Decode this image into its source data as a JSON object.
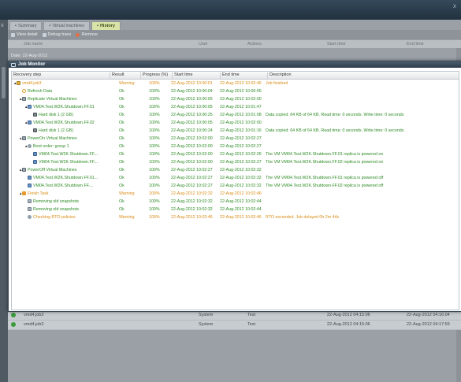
{
  "window": {
    "close_glyph": "x"
  },
  "tabs": [
    {
      "label": "Summary",
      "active": false
    },
    {
      "label": "Virtual machines",
      "active": false
    },
    {
      "label": "History",
      "active": true
    }
  ],
  "toolbar": {
    "view_detail": "View detail",
    "debug_trace": "Debug trace",
    "remove": "Remove"
  },
  "background_table": {
    "headers": {
      "job_name": "Job name",
      "user": "User",
      "actions": "Actions",
      "start": "Start time",
      "end": "End time"
    },
    "group_label": "Date: 22-Aug-2012",
    "rows": [
      {
        "name": "vmd4.job3",
        "user": "System",
        "action": "Test",
        "start": "22-Aug-2012 04:15:06",
        "end": "22-Aug-2012 04:16:04"
      },
      {
        "name": "vmd4.job3",
        "user": "System",
        "action": "Test",
        "start": "22-Aug-2012 04:15:06",
        "end": "22-Aug-2012 04:17:59"
      }
    ]
  },
  "dialog": {
    "title": "Job Monitor",
    "columns": {
      "step": "Recovery step",
      "result": "Result",
      "progress": "Progress (%)",
      "start": "Start time",
      "end": "End time",
      "description": "Description"
    },
    "rows": [
      {
        "indent": 0,
        "expander": "▲",
        "icon": "job",
        "step": "vmd4.job3",
        "result": "Warning",
        "progress": "100%",
        "start": "22-Aug-2012 10:00:01",
        "end": "22-Aug-2012 10:02:46",
        "description": "Job finished",
        "status": "warn"
      },
      {
        "indent": 1,
        "expander": "",
        "icon": "refresh",
        "step": "Refresh Data",
        "result": "Ok",
        "progress": "100%",
        "start": "22-Aug-2012 10:00:04",
        "end": "22-Aug-2012 10:00:05",
        "description": "",
        "status": "ok"
      },
      {
        "indent": 1,
        "expander": "▲",
        "icon": "repl",
        "step": "Replicate Virtual Machines",
        "result": "Ok",
        "progress": "100%",
        "start": "22-Aug-2012 10:00:05",
        "end": "22-Aug-2012 10:02:00",
        "description": "",
        "status": "ok"
      },
      {
        "indent": 2,
        "expander": "▲",
        "icon": "vm",
        "step": "VM04.Test.W2K.Shutdown.FF.01",
        "result": "Ok",
        "progress": "100%",
        "start": "22-Aug-2012 10:00:05",
        "end": "22-Aug-2012 10:01:47",
        "description": "",
        "status": "ok"
      },
      {
        "indent": 3,
        "expander": "",
        "icon": "disk",
        "step": "Hard disk 1 (2 GB)",
        "result": "Ok",
        "progress": "100%",
        "start": "22-Aug-2012 10:00:25",
        "end": "22-Aug-2012 10:01:08",
        "description": "Data copied: 64 KB of 64 KB. Read time: 0 seconds. Write time: 0 seconds",
        "status": "ok"
      },
      {
        "indent": 2,
        "expander": "▲",
        "icon": "vm",
        "step": "VM04.Test.W2K.Shutdown.FF.02",
        "result": "Ok",
        "progress": "100%",
        "start": "22-Aug-2012 10:00:05",
        "end": "22-Aug-2012 10:02:00",
        "description": "",
        "status": "ok"
      },
      {
        "indent": 3,
        "expander": "",
        "icon": "disk",
        "step": "Hard disk 1 (2 GB)",
        "result": "Ok",
        "progress": "100%",
        "start": "22-Aug-2012 10:00:24",
        "end": "22-Aug-2012 10:01:16",
        "description": "Data copied: 64 KB of 64 KB. Read time: 0 seconds. Write time: 0 seconds",
        "status": "ok"
      },
      {
        "indent": 1,
        "expander": "▲",
        "icon": "repl",
        "step": "PowerOn Virtual Machines",
        "result": "Ok",
        "progress": "100%",
        "start": "22-Aug-2012 10:02:00",
        "end": "22-Aug-2012 10:02:27",
        "description": "",
        "status": "ok"
      },
      {
        "indent": 2,
        "expander": "▲",
        "icon": "gear",
        "step": "Boot order: group 1",
        "result": "Ok",
        "progress": "100%",
        "start": "22-Aug-2012 10:02:00",
        "end": "22-Aug-2012 10:02:27",
        "description": "",
        "status": "ok"
      },
      {
        "indent": 3,
        "expander": "",
        "icon": "vm",
        "step": "VM04.Test.W2K.Shutdown.FF....",
        "result": "Ok",
        "progress": "100%",
        "start": "22-Aug-2012 10:02:00",
        "end": "22-Aug-2012 10:02:26",
        "description": "The VM VM04.Test.W2K.Shutdown.FF.01 replica is powered on",
        "status": "ok"
      },
      {
        "indent": 3,
        "expander": "",
        "icon": "vm",
        "step": "VM04.Test.W2K.Shutdown.FF....",
        "result": "Ok",
        "progress": "100%",
        "start": "22-Aug-2012 10:02:00",
        "end": "22-Aug-2012 10:02:27",
        "description": "The VM VM04.Test.W2K.Shutdown.FF.02 replica is powered on",
        "status": "ok"
      },
      {
        "indent": 1,
        "expander": "▲",
        "icon": "repl",
        "step": "PowerOff Virtual Machines",
        "result": "Ok",
        "progress": "100%",
        "start": "22-Aug-2012 10:02:27",
        "end": "22-Aug-2012 10:02:32",
        "description": "",
        "status": "ok"
      },
      {
        "indent": 2,
        "expander": "",
        "icon": "vm",
        "step": "VM04.Test.W2K.Shutdown.FF.01...",
        "result": "Ok",
        "progress": "100%",
        "start": "22-Aug-2012 10:02:27",
        "end": "22-Aug-2012 10:02:32",
        "description": "The VM VM04.Test.W2K.Shutdown.FF.01 replica is powered off",
        "status": "ok"
      },
      {
        "indent": 2,
        "expander": "",
        "icon": "vm",
        "step": "VM04.Test.W2K.Shutdown.FF....",
        "result": "Ok",
        "progress": "100%",
        "start": "22-Aug-2012 10:02:27",
        "end": "22-Aug-2012 10:02:32",
        "description": "The VM VM04.Test.W2K.Shutdown.FF.02 replica is powered off",
        "status": "ok"
      },
      {
        "indent": 1,
        "expander": "▲",
        "icon": "flag",
        "step": "Finish Task",
        "result": "Warning",
        "progress": "100%",
        "start": "22-Aug-2012 10:02:32",
        "end": "22-Aug-2012 10:02:46",
        "description": "",
        "status": "warn"
      },
      {
        "indent": 2,
        "expander": "",
        "icon": "del",
        "step": "Removing old snapshots",
        "result": "Ok",
        "progress": "100%",
        "start": "22-Aug-2012 10:02:32",
        "end": "22-Aug-2012 10:02:44",
        "description": "",
        "status": "ok"
      },
      {
        "indent": 2,
        "expander": "",
        "icon": "del",
        "step": "Removing old snapshots",
        "result": "Ok",
        "progress": "100%",
        "start": "22-Aug-2012 10:02:32",
        "end": "22-Aug-2012 10:02:44",
        "description": "",
        "status": "ok"
      },
      {
        "indent": 2,
        "expander": "",
        "icon": "gear",
        "step": "Checking RTO policies",
        "result": "Warning",
        "progress": "100%",
        "start": "22-Aug-2012 10:02:46",
        "end": "22-Aug-2012 10:02:46",
        "description": "RTO exceeded. Job delayed 0h 2m 44s",
        "status": "warn"
      }
    ]
  },
  "colors": {
    "ok": "#2e8b25",
    "warning": "#d98c14",
    "title_bar": "#2e3d4a"
  }
}
